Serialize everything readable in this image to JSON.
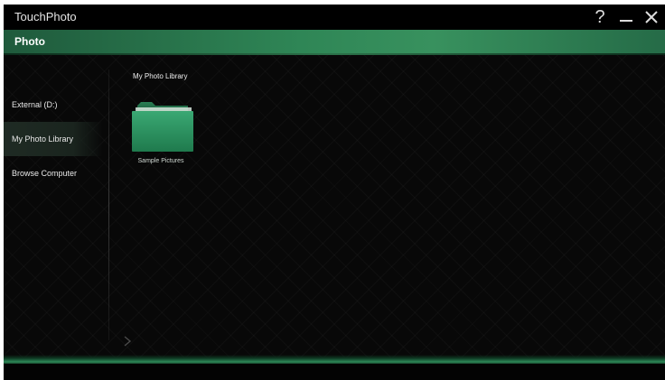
{
  "window": {
    "title": "TouchPhoto",
    "help_label": "?",
    "close_label": "✕"
  },
  "header": {
    "title": "Photo"
  },
  "sidebar": {
    "items": [
      {
        "label": "External (D:)",
        "active": false
      },
      {
        "label": "My Photo Library",
        "active": true
      },
      {
        "label": "Browse Computer",
        "active": false
      }
    ]
  },
  "main": {
    "breadcrumb": "My Photo Library",
    "folders": [
      {
        "label": "Sample Pictures",
        "icon": "folder-icon"
      }
    ]
  },
  "colors": {
    "accent": "#2f8656",
    "folder_green": "#2a9462",
    "background": "#070707"
  }
}
